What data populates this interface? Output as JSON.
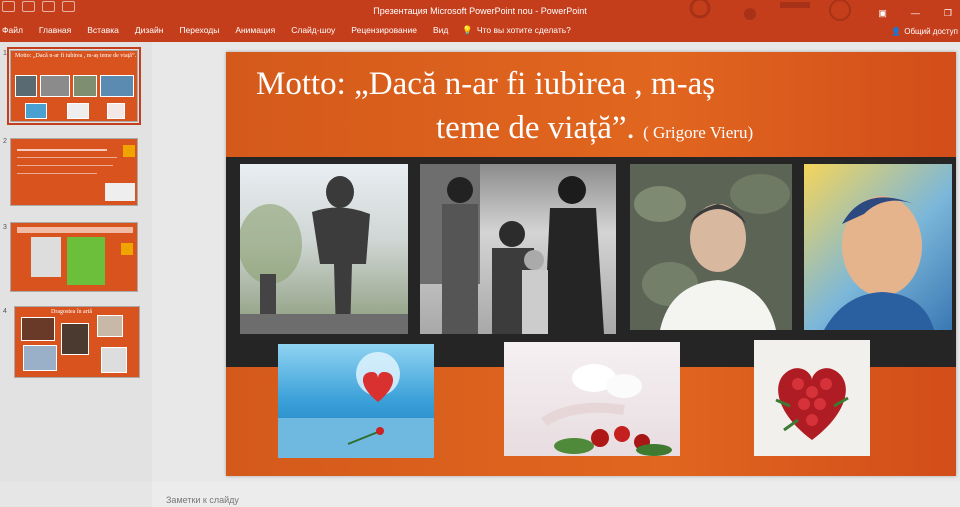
{
  "window": {
    "title": "Презентация Microsoft PowerPoint nou - PowerPoint",
    "share_label": "Общий доступ"
  },
  "ribbon": {
    "tabs": [
      "Файл",
      "Главная",
      "Вставка",
      "Дизайн",
      "Переходы",
      "Анимация",
      "Слайд-шоу",
      "Рецензирование",
      "Вид"
    ],
    "tell_me": "Что вы хотите сделать?"
  },
  "thumbnails": {
    "numbers": [
      "1",
      "2",
      "3",
      "4"
    ],
    "slide1_title": "Motto: „Dacă n-ar fi iubirea , m-aș teme de viață”.",
    "slide4_title": "Dragostea în artă"
  },
  "slide": {
    "motto_line1": "Motto: „Dacă n-ar fi iubirea , m-aș",
    "motto_line2": "teme de viață”.",
    "author": "( Grigore Vieru)"
  },
  "notes_placeholder": "Заметки к слайду",
  "colors": {
    "ribbon": "#c43e1c",
    "slide_orange": "#e1661f",
    "band": "#252525"
  }
}
